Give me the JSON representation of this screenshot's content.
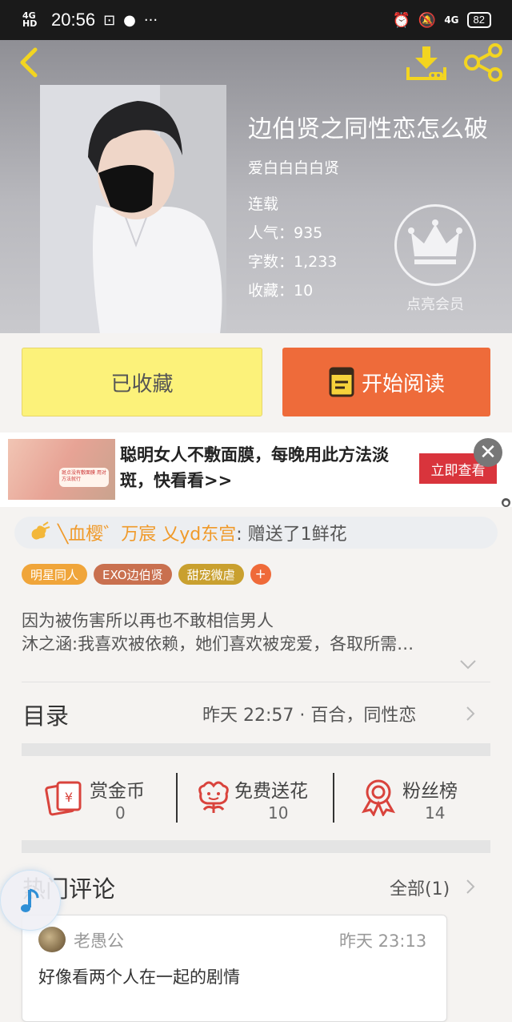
{
  "status_bar": {
    "network": "4G HD",
    "time": "20:56",
    "battery": "82",
    "signal_right": "4G"
  },
  "book": {
    "title": "边伯贤之同性恋怎么破",
    "author": "爱白白白白贤",
    "status": "连载",
    "popularity": "人气：935",
    "word_count": "字数：1,233",
    "favorites": "收藏：10"
  },
  "vip": {
    "label": "点亮会员"
  },
  "actions": {
    "favorited_label": "已收藏",
    "start_reading_label": "开始阅读"
  },
  "ad": {
    "text": "聪明女人不敷面膜，每晚用此方法淡斑，快看看>>",
    "button": "立即查看",
    "image_caption": "斑点没有敷面膜 用对方法就行"
  },
  "gift": {
    "user": "╲血樱゛万宸 乂yd东宫",
    "text": ": 赠送了1鲜花"
  },
  "tags": [
    {
      "label": "明星同人",
      "color": "#f0a53a"
    },
    {
      "label": "EXO边伯贤",
      "color": "#c9704f"
    },
    {
      "label": "甜宠微虐",
      "color": "#c9a02f"
    }
  ],
  "tag_add": "+",
  "intro": {
    "line1": "因为被伤害所以再也不敢相信男人",
    "line2": "沐之涵:我喜欢被依赖，她们喜欢被宠爱，各取所需…"
  },
  "toc": {
    "title": "目录",
    "meta": "昨天 22:57 · 百合，同性恋"
  },
  "stats": {
    "coins": {
      "label": "赏金币",
      "value": "0"
    },
    "flowers": {
      "label": "免费送花",
      "value": "10"
    },
    "fans": {
      "label": "粉丝榜",
      "value": "14"
    }
  },
  "comments": {
    "title": "热门评论",
    "all_label": "全部(1)",
    "items": [
      {
        "user": "老愚公",
        "time": "昨天 23:13",
        "text": "好像看两个人在一起的剧情"
      }
    ]
  },
  "colors": {
    "accent_orange": "#ee6b3a",
    "fav_yellow": "#fcf27a",
    "icon_red": "#d9433c",
    "ad_red": "#d9343c"
  }
}
